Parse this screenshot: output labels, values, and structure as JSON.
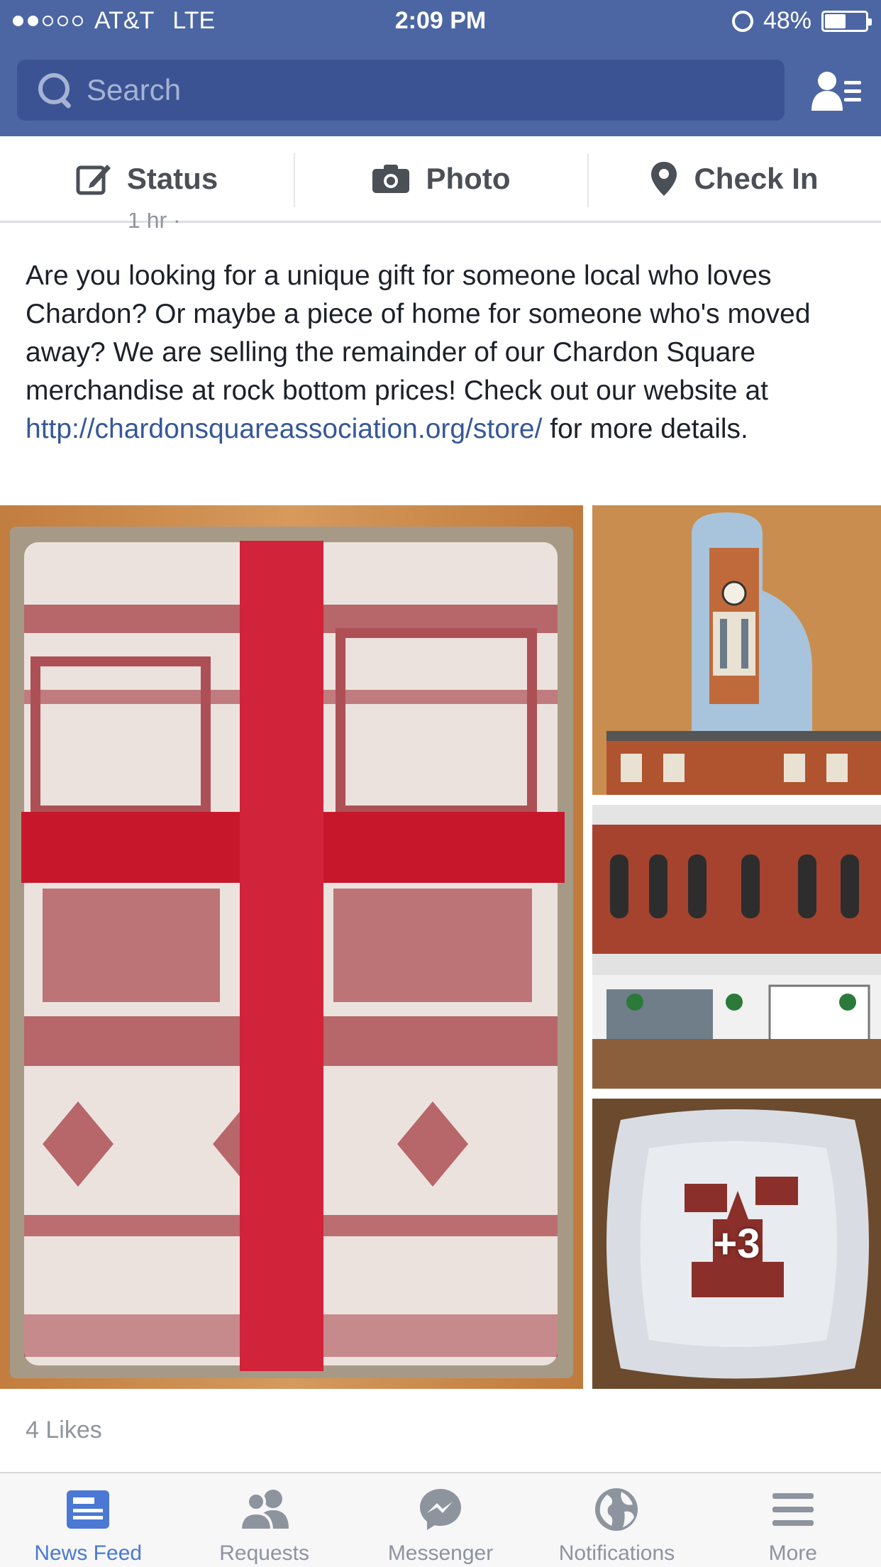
{
  "statusbar": {
    "carrier": "AT&T",
    "network": "LTE",
    "time": "2:09 PM",
    "battery": "48%",
    "battery_level": 0.48,
    "signal_bars_filled": 2,
    "signal_bars_total": 5
  },
  "search": {
    "placeholder": "Search",
    "icon": "search-icon"
  },
  "header": {
    "friends_icon": "friend-requests-icon"
  },
  "composer": {
    "status_label": "Status",
    "photo_label": "Photo",
    "checkin_label": "Check In"
  },
  "post": {
    "time_partial": "1 hr ·",
    "text_before_link": "Are you looking for a unique gift for someone local who loves Chardon? Or maybe a piece of home for someone who's moved away? We are selling the remainder of our Chardon Square merchandise at rock bottom prices! Check out our website at ",
    "link": "http://chardonsquareassociation.org/store/",
    "text_after_link": " for more details.",
    "more_photos": "+3",
    "likes": "4 Likes"
  },
  "tabs": [
    {
      "label": "News Feed",
      "icon": "news-feed-icon",
      "active": true
    },
    {
      "label": "Requests",
      "icon": "requests-icon",
      "active": false
    },
    {
      "label": "Messenger",
      "icon": "messenger-icon",
      "active": false
    },
    {
      "label": "Notifications",
      "icon": "notifications-globe-icon",
      "active": false
    },
    {
      "label": "More",
      "icon": "more-menu-icon",
      "active": false
    }
  ],
  "colors": {
    "brand_blue": "#4c66a4",
    "search_bg": "#3b5393",
    "link": "#365899",
    "active_tab": "#4a78d4",
    "inactive": "#8d949e"
  }
}
